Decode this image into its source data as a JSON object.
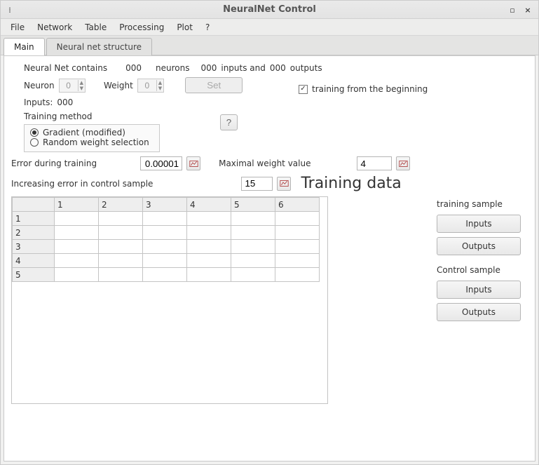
{
  "window": {
    "title": "NeuralNet Control"
  },
  "menubar": {
    "items": [
      "File",
      "Network",
      "Table",
      "Processing",
      "Plot",
      "?"
    ]
  },
  "tabs": [
    {
      "label": "Main",
      "active": true
    },
    {
      "label": "Neural net structure",
      "active": false
    }
  ],
  "summary": {
    "prefix": "Neural Net contains",
    "neurons_count": "000",
    "neurons_label": "neurons",
    "inputs_count": "000",
    "inputs_and_label": "inputs and",
    "outputs_count": "000",
    "outputs_label": "outputs"
  },
  "neuron": {
    "label": "Neuron",
    "value": "0"
  },
  "weight": {
    "label": "Weight",
    "value": "0"
  },
  "set_button": "Set",
  "inputs_line": {
    "label": "Inputs:",
    "value": "000"
  },
  "training_from_beginning": {
    "checked": true,
    "label": "training from the beginning"
  },
  "training_method": {
    "label": "Training method",
    "help": "?",
    "options": [
      {
        "label": "Gradient (modified)",
        "checked": true
      },
      {
        "label": "Random weight selection",
        "checked": false
      }
    ]
  },
  "error_during_training": {
    "label": "Error during training",
    "value": "0.00001"
  },
  "maximal_weight": {
    "label": "Maximal weight value",
    "value": "4"
  },
  "increasing_error": {
    "label": "Increasing error in control sample",
    "value": "15"
  },
  "training_data_title": "Training data",
  "table": {
    "columns": [
      "1",
      "2",
      "3",
      "4",
      "5",
      "6"
    ],
    "rows": [
      "1",
      "2",
      "3",
      "4",
      "5"
    ]
  },
  "right_panel": {
    "training_sample_label": "training sample",
    "control_sample_label": "Control sample",
    "inputs_btn": "Inputs",
    "outputs_btn": "Outputs"
  }
}
